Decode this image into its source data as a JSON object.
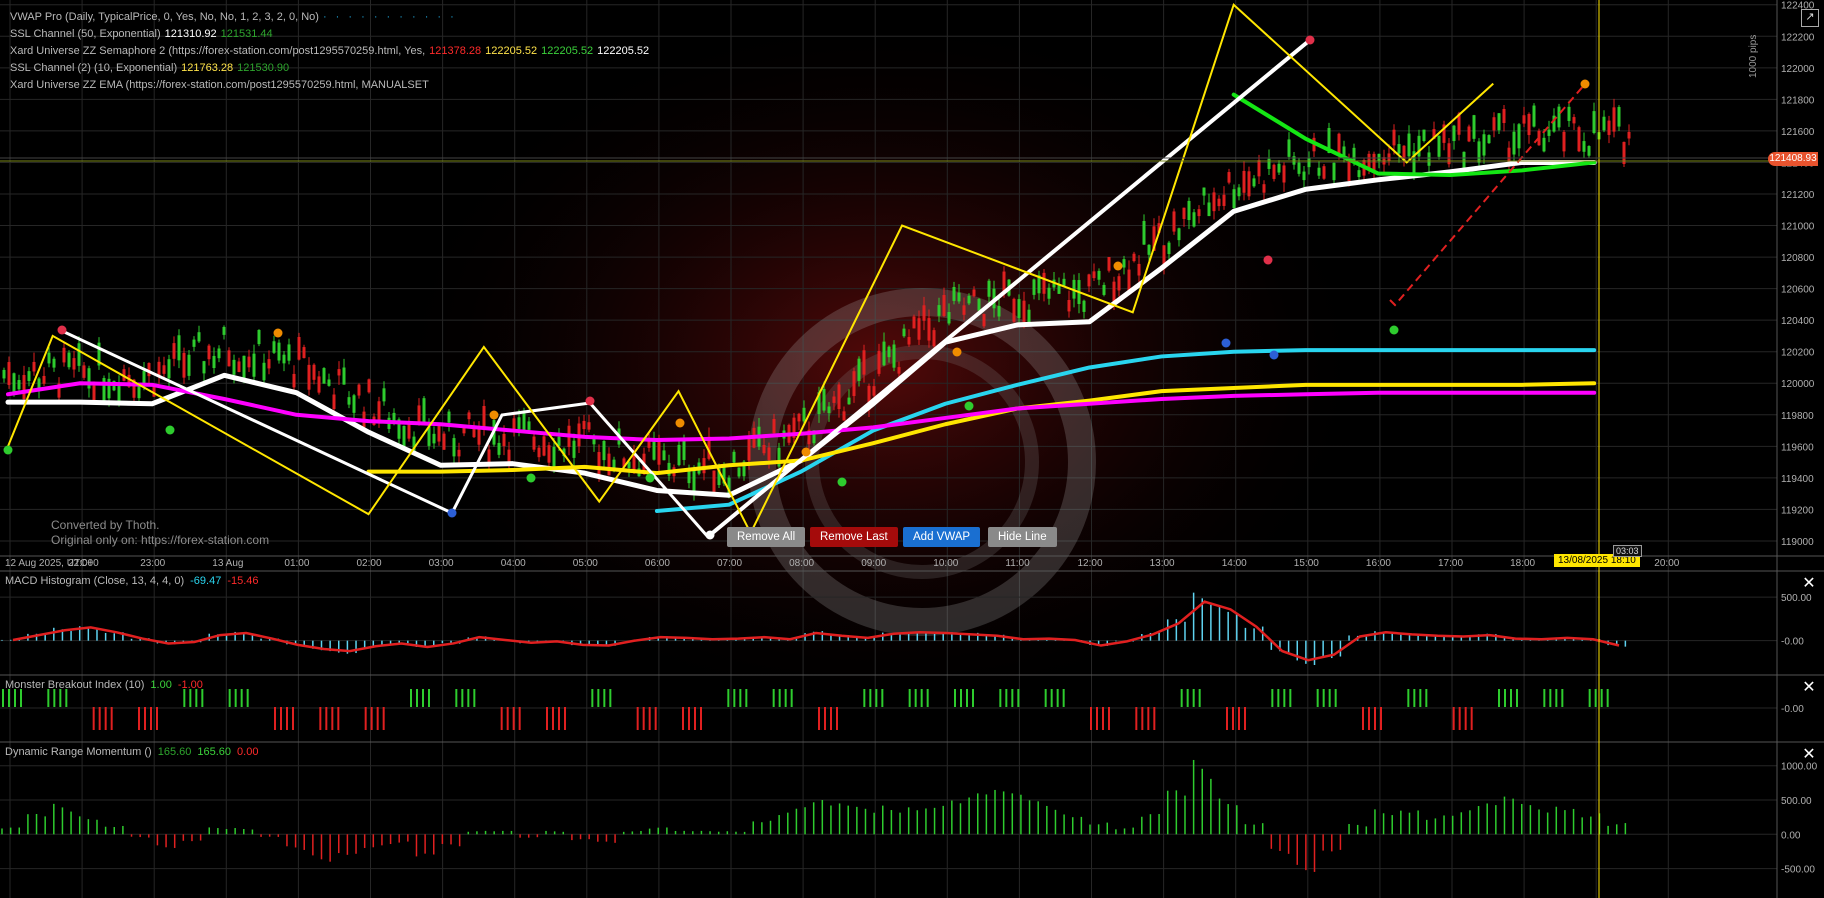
{
  "legend": {
    "vwap": "VWAP Pro (Daily, TypicalPrice, 0, Yes, No, No, 1, 2, 3, 2, 0, No)",
    "ssl50": "SSL Channel (50, Exponential)",
    "ssl50_v1": "121310.92",
    "ssl50_v2": "121531.44",
    "zz_sema": "Xard Universe ZZ Semaphore 2 (https://forex-station.com/post1295570259.html, Yes,",
    "zz_v1": "121378.28",
    "zz_v2": "122205.52",
    "zz_v3": "122205.52",
    "zz_v4": "122205.52",
    "ssl10": "SSL Channel (2) (10, Exponential)",
    "ssl10_v1": "121763.28",
    "ssl10_v2": "121530.90",
    "zz_ema": "Xard Universe ZZ EMA (https://forex-station.com/post1295570259.html, MANUALSET"
  },
  "watermark": {
    "line1": "Converted by Thoth.",
    "line2": "Original only on: https://forex-station.com"
  },
  "buttons": {
    "remove_all": "Remove All",
    "remove_last": "Remove Last",
    "add_vwap": "Add VWAP",
    "hide_line": "Hide Line"
  },
  "price_tag": "121408.93",
  "time_tag": "13/08/2025 18:10",
  "cursor_time": "03:03",
  "pips_label": "1000 pips",
  "macd": {
    "title": "MACD Histogram (Close, 13, 4, 4, 0)",
    "v1": "-69.47",
    "v2": "-15.46"
  },
  "mbi": {
    "title": "Monster Breakout Index (10)",
    "v1": "1.00",
    "v2": "-1.00"
  },
  "drm": {
    "title": "Dynamic Range Momentum ()",
    "v1": "165.60",
    "v2": "165.60",
    "v3": "0.00"
  },
  "colors": {
    "bg": "#000000",
    "grid": "#262626",
    "up": "#2ecc2e",
    "down": "#e02020",
    "white": "#ffffff",
    "yellow": "#ffe600",
    "cyan": "#29d5ef",
    "magenta": "#ff00ff"
  },
  "chart_data": [
    {
      "type": "line",
      "title": "",
      "x_ticks": [
        "12 Aug 2025, UTC+0",
        "22:00",
        "23:00",
        "13 Aug",
        "01:00",
        "02:00",
        "03:00",
        "04:00",
        "05:00",
        "06:00",
        "07:00",
        "08:00",
        "09:00",
        "10:00",
        "11:00",
        "12:00",
        "13:00",
        "14:00",
        "15:00",
        "16:00",
        "17:00",
        "18:00",
        "19:00",
        "20:00"
      ],
      "y_ticks": [
        "122400",
        "122200",
        "122000",
        "121800",
        "121600",
        "121400",
        "121200",
        "121000",
        "120800",
        "120600",
        "120400",
        "120200",
        "120000",
        "119800",
        "119600",
        "119400",
        "119200",
        "119000"
      ],
      "ylim": [
        118930,
        122430
      ],
      "series": [
        {
          "name": "SSL Channel (50, Exponential)",
          "color": "#ffffff",
          "x": [
            0,
            1,
            2,
            3,
            4,
            5,
            6,
            7,
            8,
            9,
            10,
            11,
            12,
            13,
            14,
            15,
            16,
            17,
            18,
            19,
            20,
            21,
            22
          ],
          "values": [
            119880,
            119880,
            119870,
            120050,
            119940,
            119690,
            119480,
            119490,
            119430,
            119320,
            119290,
            119510,
            119870,
            120260,
            120370,
            120390,
            120730,
            121090,
            121230,
            121290,
            121340,
            121400,
            121400
          ]
        },
        {
          "name": "",
          "color": "#29d5ef",
          "x": [
            9,
            10,
            11,
            12,
            13,
            14,
            15,
            16,
            17,
            18,
            19,
            20,
            21,
            22
          ],
          "values": [
            119190,
            119230,
            119440,
            119700,
            119870,
            119990,
            120100,
            120170,
            120200,
            120210,
            120210,
            120210,
            120210,
            120210
          ]
        },
        {
          "name": "",
          "color": "#ffe600",
          "x": [
            5,
            6,
            7,
            8,
            9,
            10,
            11,
            12,
            13,
            14,
            15,
            16,
            17,
            18,
            19,
            20,
            21,
            22
          ],
          "values": [
            119440,
            119440,
            119450,
            119470,
            119430,
            119480,
            119510,
            119620,
            119740,
            119840,
            119890,
            119950,
            119970,
            119990,
            119990,
            119990,
            119990,
            120000
          ]
        },
        {
          "name": "",
          "color": "#ff00ff",
          "x": [
            0,
            1,
            2,
            3,
            4,
            5,
            6,
            7,
            8,
            9,
            10,
            11,
            12,
            13,
            14,
            15,
            16,
            17,
            18,
            19,
            20,
            21,
            22
          ],
          "values": [
            119930,
            120000,
            119990,
            119900,
            119800,
            119760,
            119740,
            119700,
            119660,
            119640,
            119650,
            119680,
            119720,
            119780,
            119840,
            119870,
            119900,
            119920,
            119930,
            119940,
            119940,
            119940,
            119940
          ]
        },
        {
          "name": "",
          "color": "#14e614",
          "x": [
            17,
            18,
            19,
            20,
            21,
            22
          ],
          "values": [
            121830,
            121550,
            121330,
            121320,
            121350,
            121400
          ]
        }
      ]
    },
    {
      "type": "bar",
      "title": "MACD Histogram (Close, 13, 4, 4, 0)",
      "y_ticks": [
        "500.00",
        "-0.00"
      ],
      "ylim": [
        -360,
        720
      ],
      "values": [
        10,
        80,
        150,
        190,
        120,
        30,
        -40,
        -20,
        80,
        110,
        30,
        -60,
        -120,
        -150,
        -80,
        -40,
        -90,
        -40,
        50,
        10,
        -30,
        -10,
        -60,
        -70,
        0,
        50,
        40,
        20,
        30,
        50,
        20,
        110,
        70,
        40,
        100,
        120,
        110,
        90,
        70,
        20,
        30,
        10,
        -70,
        -10,
        90,
        250,
        560,
        450,
        200,
        -150,
        -280,
        -200,
        60,
        120,
        90,
        70,
        60,
        80,
        30,
        20,
        40,
        20,
        -69.47
      ]
    },
    {
      "type": "bar",
      "title": "Monster Breakout Index (10)",
      "y_ticks": [
        "-0.00"
      ],
      "values": [
        1,
        1,
        -1,
        -1,
        1,
        1,
        -1,
        -1,
        -1,
        1,
        1,
        -1,
        -1,
        1,
        -1,
        -1,
        1,
        1,
        -1,
        1,
        1,
        1,
        1,
        1,
        -1,
        -1,
        1,
        -1,
        1,
        1,
        -1,
        1,
        -1,
        1,
        1,
        1
      ]
    },
    {
      "type": "bar",
      "title": "Dynamic Range Momentum ()",
      "y_ticks": [
        "1000.00",
        "500.00",
        "0.00",
        "-500.00"
      ],
      "ylim": [
        -900,
        1200
      ],
      "values": [
        100,
        300,
        450,
        300,
        150,
        -50,
        -200,
        -100,
        100,
        100,
        -50,
        -250,
        -400,
        -300,
        -200,
        -150,
        -400,
        -200,
        50,
        50,
        -50,
        50,
        -100,
        -150,
        50,
        100,
        50,
        50,
        50,
        250,
        400,
        500,
        450,
        400,
        450,
        500,
        550,
        600,
        650,
        600,
        500,
        350,
        200,
        100,
        300,
        650,
        1100,
        600,
        200,
        -300,
        -550,
        -250,
        150,
        400,
        450,
        300,
        350,
        450,
        550,
        450,
        500,
        350,
        165.6
      ]
    }
  ]
}
